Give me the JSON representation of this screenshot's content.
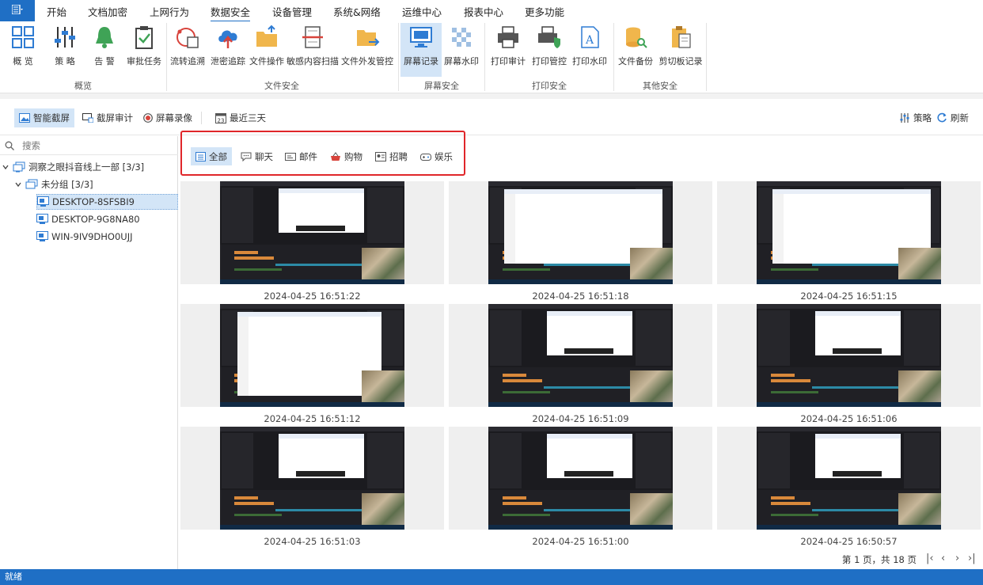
{
  "app_menu_icon": "menu-icon",
  "menu": [
    "开始",
    "文档加密",
    "上网行为",
    "数据安全",
    "设备管理",
    "系统&网络",
    "运维中心",
    "报表中心",
    "更多功能"
  ],
  "ribbon": {
    "buttons": [
      "概 览",
      "策 略",
      "告 警",
      "审批任务",
      "流转追溯",
      "泄密追踪",
      "文件操作",
      "敏感内容扫描",
      "文件外发管控",
      "屏幕记录",
      "屏幕水印",
      "打印审计",
      "打印管控",
      "打印水印",
      "文件备份",
      "剪切板记录"
    ],
    "groups": [
      "概览",
      "文件安全",
      "屏幕安全",
      "打印安全",
      "其他安全"
    ]
  },
  "toolbar": {
    "smart_screen": "智能截屏",
    "screenshot_audit": "截屏审计",
    "screen_record": "屏幕录像",
    "date_range": "最近三天",
    "policy": "策略",
    "refresh": "刷新"
  },
  "tree": {
    "search_placeholder": "搜索",
    "root": "洞察之眼抖音线上一部 [3/3]",
    "group": "未分组 [3/3]",
    "devices": [
      "DESKTOP-8SFSBI9",
      "DESKTOP-9G8NA80",
      "WIN-9IV9DHO0UJJ"
    ]
  },
  "filters": [
    "全部",
    "聊天",
    "邮件",
    "购物",
    "招聘",
    "娱乐"
  ],
  "screenshots": [
    {
      "time": "2024-04-25 16:51:22"
    },
    {
      "time": "2024-04-25 16:51:18"
    },
    {
      "time": "2024-04-25 16:51:15"
    },
    {
      "time": "2024-04-25 16:51:12"
    },
    {
      "time": "2024-04-25 16:51:09"
    },
    {
      "time": "2024-04-25 16:51:06"
    },
    {
      "time": "2024-04-25 16:51:03"
    },
    {
      "time": "2024-04-25 16:51:00"
    },
    {
      "time": "2024-04-25 16:50:57"
    }
  ],
  "pager": {
    "text": "第 1 页，共 18 页"
  },
  "status": "就绪",
  "colors": {
    "accent": "#1f6fc5",
    "selected": "#d3e5f7",
    "highlight_border": "#e0262a"
  }
}
